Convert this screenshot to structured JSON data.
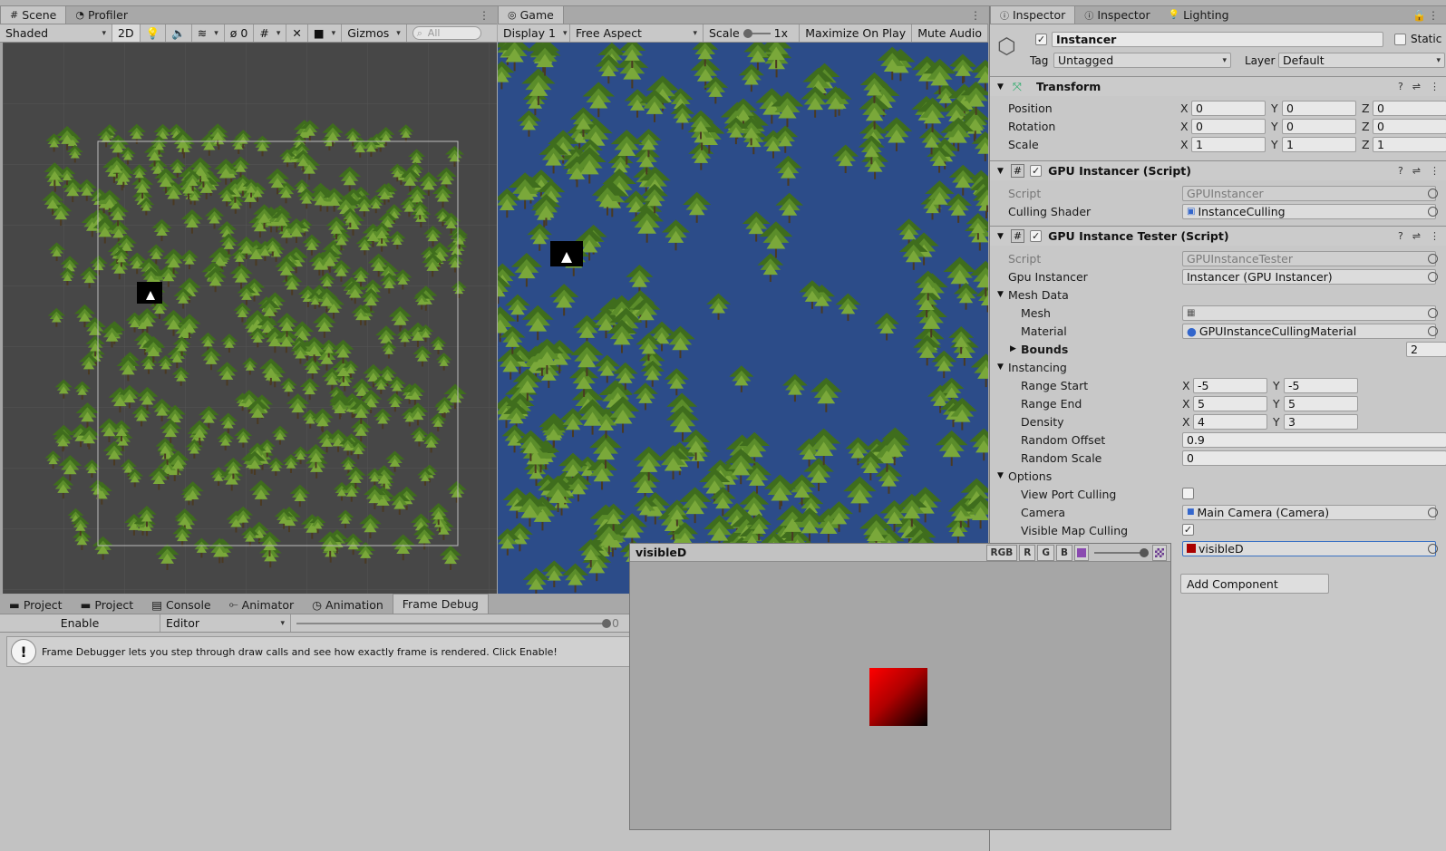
{
  "scene_panel": {
    "tabs": [
      {
        "label": "Scene",
        "icon": "grid-icon"
      },
      {
        "label": "Profiler",
        "icon": "profiler-icon"
      }
    ],
    "toolbar": {
      "shading": "Shaded",
      "mode_2d": "2D",
      "hidden_count": "0",
      "gizmos": "Gizmos",
      "search_placeholder": "All"
    }
  },
  "game_panel": {
    "tabs": [
      {
        "label": "Game",
        "icon": "gamepad-icon"
      }
    ],
    "toolbar": {
      "display": "Display 1",
      "aspect": "Free Aspect",
      "scale_label": "Scale",
      "scale_value": "1x",
      "maximize": "Maximize On Play",
      "mute": "Mute Audio"
    }
  },
  "inspector": {
    "tabs": [
      {
        "label": "Inspector"
      },
      {
        "label": "Inspector"
      },
      {
        "label": "Lighting"
      }
    ],
    "object_name": "Instancer",
    "static_label": "Static",
    "tag_label": "Tag",
    "tag_value": "Untagged",
    "layer_label": "Layer",
    "layer_value": "Default",
    "transform": {
      "title": "Transform",
      "rows": [
        {
          "label": "Position",
          "x": "0",
          "y": "0",
          "z": "0"
        },
        {
          "label": "Rotation",
          "x": "0",
          "y": "0",
          "z": "0"
        },
        {
          "label": "Scale",
          "x": "1",
          "y": "1",
          "z": "1"
        }
      ]
    },
    "gpu_instancer": {
      "title": "GPU Instancer (Script)",
      "script_label": "Script",
      "script_value": "GPUInstancer",
      "shader_label": "Culling Shader",
      "shader_value": "InstanceCulling"
    },
    "tester": {
      "title": "GPU Instance Tester (Script)",
      "script_label": "Script",
      "script_value": "GPUInstanceTester",
      "gpu_label": "Gpu Instancer",
      "gpu_value": "Instancer (GPU Instancer)",
      "mesh_data_label": "Mesh Data",
      "mesh_label": "Mesh",
      "material_label": "Material",
      "material_value": "GPUInstanceCullingMaterial",
      "bounds_label": "Bounds",
      "bounds_value": "2",
      "instancing_label": "Instancing",
      "range_start_label": "Range Start",
      "range_start_x": "-5",
      "range_start_y": "-5",
      "range_end_label": "Range End",
      "range_end_x": "5",
      "range_end_y": "5",
      "density_label": "Density",
      "density_x": "4",
      "density_y": "3",
      "random_offset_label": "Random Offset",
      "random_offset_value": "0.9",
      "random_scale_label": "Random Scale",
      "random_scale_value": "0",
      "options_label": "Options",
      "viewport_culling_label": "View Port Culling",
      "camera_label": "Camera",
      "camera_value": "Main Camera (Camera)",
      "visible_map_culling_label": "Visible Map Culling",
      "visible_map_value": "visibleD"
    },
    "add_component": "Add Component"
  },
  "bottom_panel": {
    "tabs": [
      {
        "label": "Project"
      },
      {
        "label": "Project"
      },
      {
        "label": "Console"
      },
      {
        "label": "Animator"
      },
      {
        "label": "Animation"
      },
      {
        "label": "Frame Debug"
      }
    ],
    "enable_button": "Enable",
    "target_value": "Editor",
    "slider_value": "0",
    "info_text": "Frame Debugger lets you step through draw calls and see how exactly frame is rendered. Click Enable!"
  },
  "texture_preview": {
    "title": "visibleD",
    "channels": [
      "RGB",
      "R",
      "G",
      "B"
    ],
    "swatch_color": "#e00000"
  },
  "colors": {
    "accent_blue": "#3a72c4",
    "game_bg": "#2c4c89",
    "scene_bg": "#474747",
    "tree_green": "#5f8f2a"
  }
}
